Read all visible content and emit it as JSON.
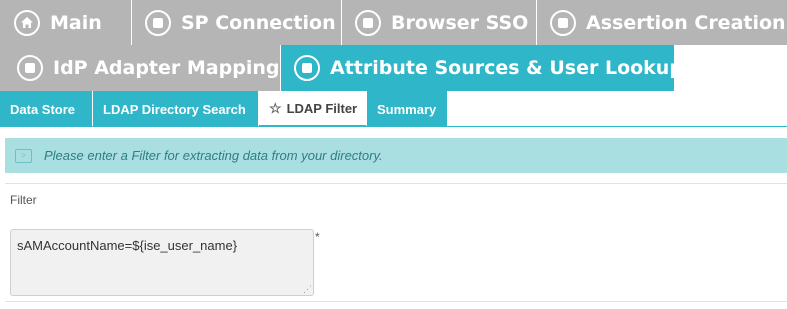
{
  "nav": {
    "row1": [
      {
        "label": "Main",
        "icon": "home-icon"
      },
      {
        "label": "SP Connection",
        "icon": "stop-circle-icon"
      },
      {
        "label": "Browser SSO",
        "icon": "stop-circle-icon"
      },
      {
        "label": "Assertion Creation",
        "icon": "stop-circle-icon"
      }
    ],
    "row2": [
      {
        "label": "IdP Adapter Mapping",
        "icon": "stop-circle-icon"
      },
      {
        "label": "Attribute Sources & User Lookup",
        "icon": "stop-circle-icon",
        "active": true
      }
    ]
  },
  "subtabs": [
    {
      "label": "Data Store"
    },
    {
      "label": "LDAP Directory Search"
    },
    {
      "label": "LDAP Filter",
      "active": true,
      "icon": "star-icon"
    },
    {
      "label": "Summary"
    }
  ],
  "info": {
    "message": "Please enter a Filter for extracting data from your directory."
  },
  "form": {
    "filter_label": "Filter",
    "filter_value": "sAMAccountName=${ise_user_name}",
    "required_marker": "*"
  },
  "colors": {
    "tab_inactive": "#b5b5b5",
    "tab_active": "#2fb6c8",
    "info_background": "#aadfe2",
    "info_text": "#2f7d85"
  }
}
